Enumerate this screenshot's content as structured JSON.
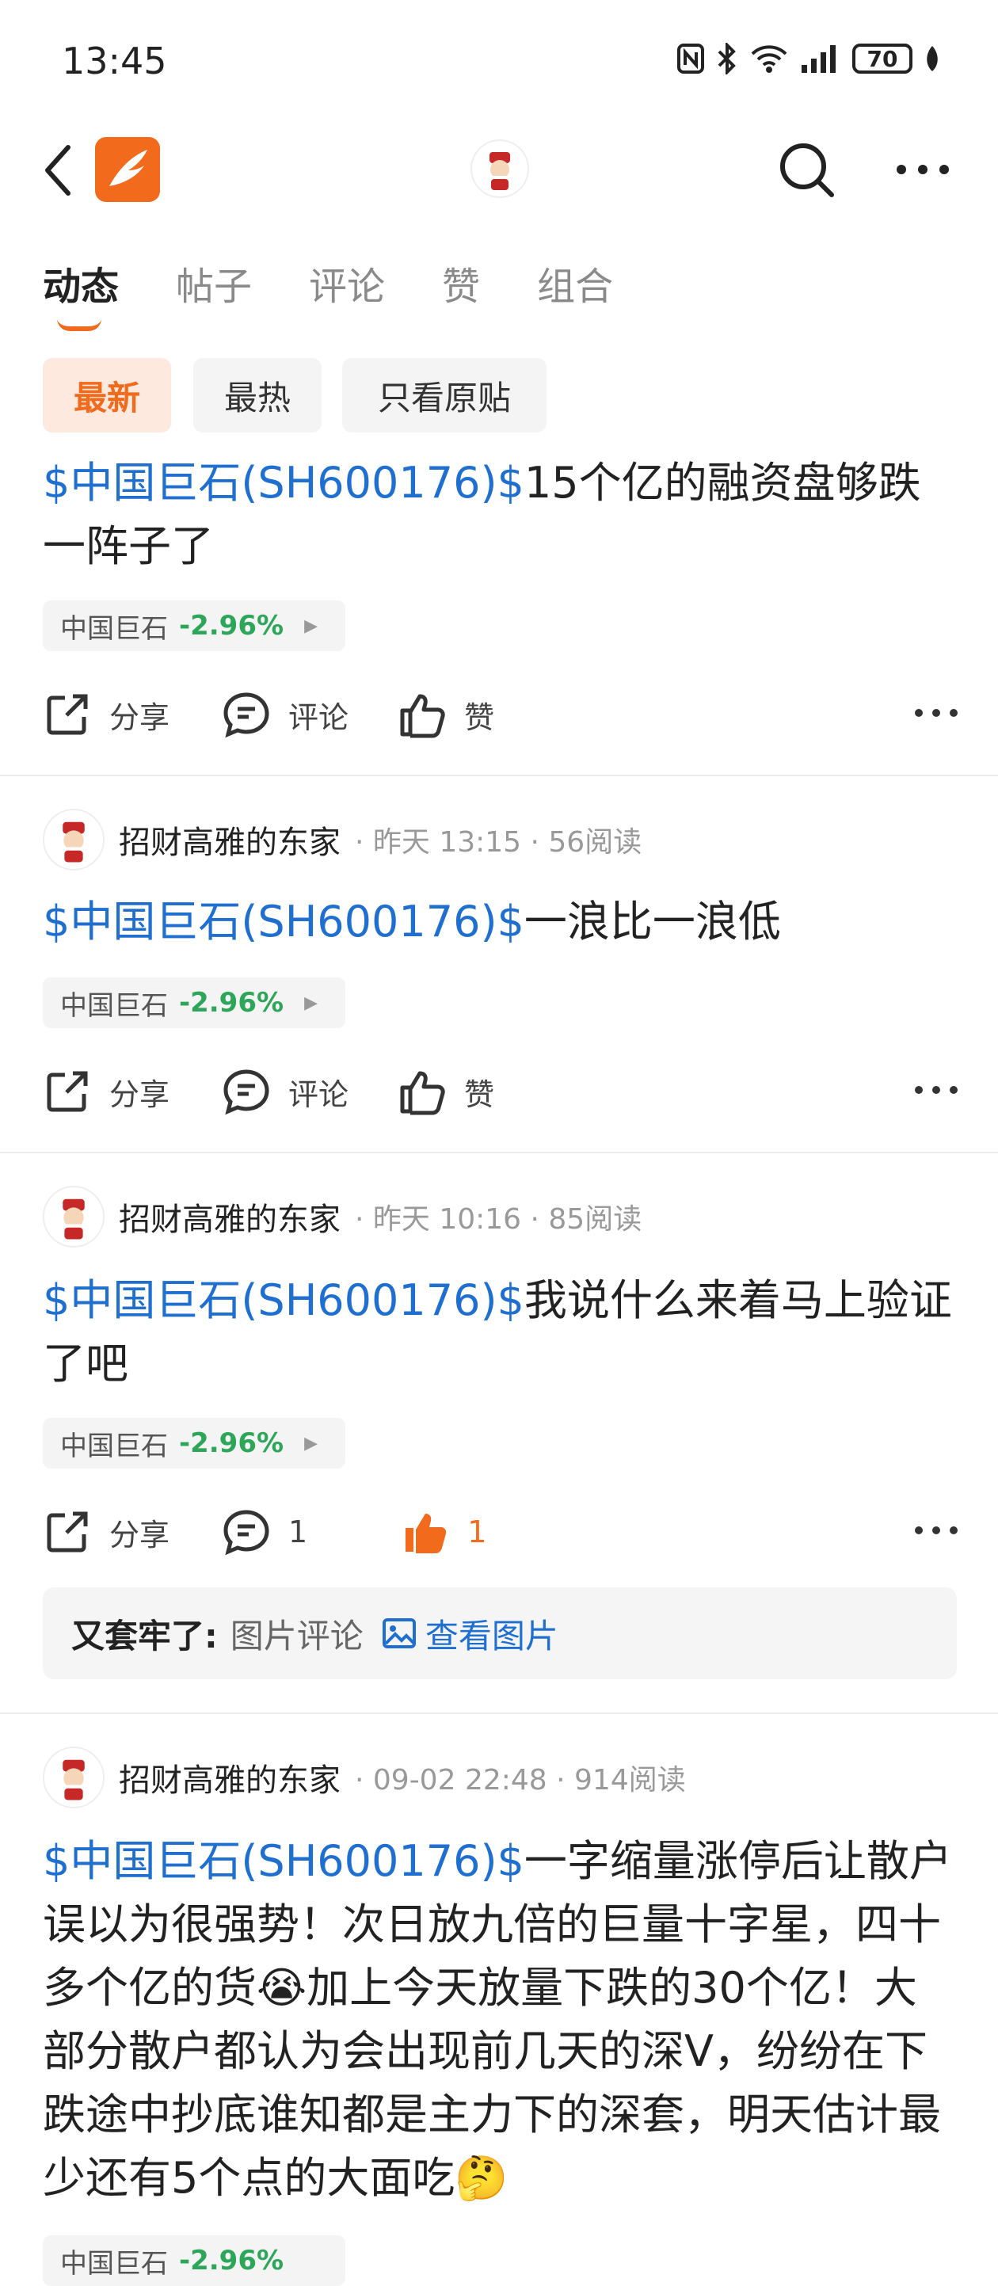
{
  "status_bar": {
    "time": "13:45",
    "battery": "70"
  },
  "tabs": [
    {
      "label": "动态"
    },
    {
      "label": "帖子"
    },
    {
      "label": "评论"
    },
    {
      "label": "赞"
    },
    {
      "label": "组合"
    }
  ],
  "filters": [
    {
      "label": "最新"
    },
    {
      "label": "最热"
    },
    {
      "label": "只看原贴"
    }
  ],
  "posts": [
    {
      "stock": "$中国巨石(SH600176)$",
      "text": "15个亿的融资盘够跌一阵子了",
      "chip_name": "中国巨石",
      "chip_pct": "-2.96%",
      "share": "分享",
      "comment": "评论",
      "like": "赞"
    },
    {
      "author": "招财高雅的东家",
      "meta": "· 昨天 13:15 · 56阅读",
      "stock": "$中国巨石(SH600176)$",
      "text": "一浪比一浪低",
      "chip_name": "中国巨石",
      "chip_pct": "-2.96%",
      "share": "分享",
      "comment": "评论",
      "like": "赞"
    },
    {
      "author": "招财高雅的东家",
      "meta": "· 昨天 10:16 · 85阅读",
      "stock": "$中国巨石(SH600176)$",
      "text": "我说什么来着马上验证了吧",
      "chip_name": "中国巨石",
      "chip_pct": "-2.96%",
      "share": "分享",
      "comment": "1",
      "like": "1",
      "comment_preview": {
        "user": "又套牢了:",
        "text": "图片评论",
        "link": "查看图片"
      }
    },
    {
      "author": "招财高雅的东家",
      "meta": "· 09-02 22:48 · 914阅读",
      "stock": "$中国巨石(SH600176)$",
      "text_a": "一字缩量涨停后让散户误以为很强势！次日放九倍的巨量十字星，四十多个亿的货",
      "text_b": "加上今天放量下跌的30个亿！大部分散户都认为会出现前几天的深V，纷纷在下跌途中抄底谁知都是主力下的深套，明天估计最少还有5个点的大面吃",
      "chip_name": "中国巨石",
      "chip_pct": "-2.96%"
    }
  ],
  "colors": {
    "accent": "#f26a1b",
    "link": "#1f6fd1",
    "down": "#2ea65a"
  }
}
